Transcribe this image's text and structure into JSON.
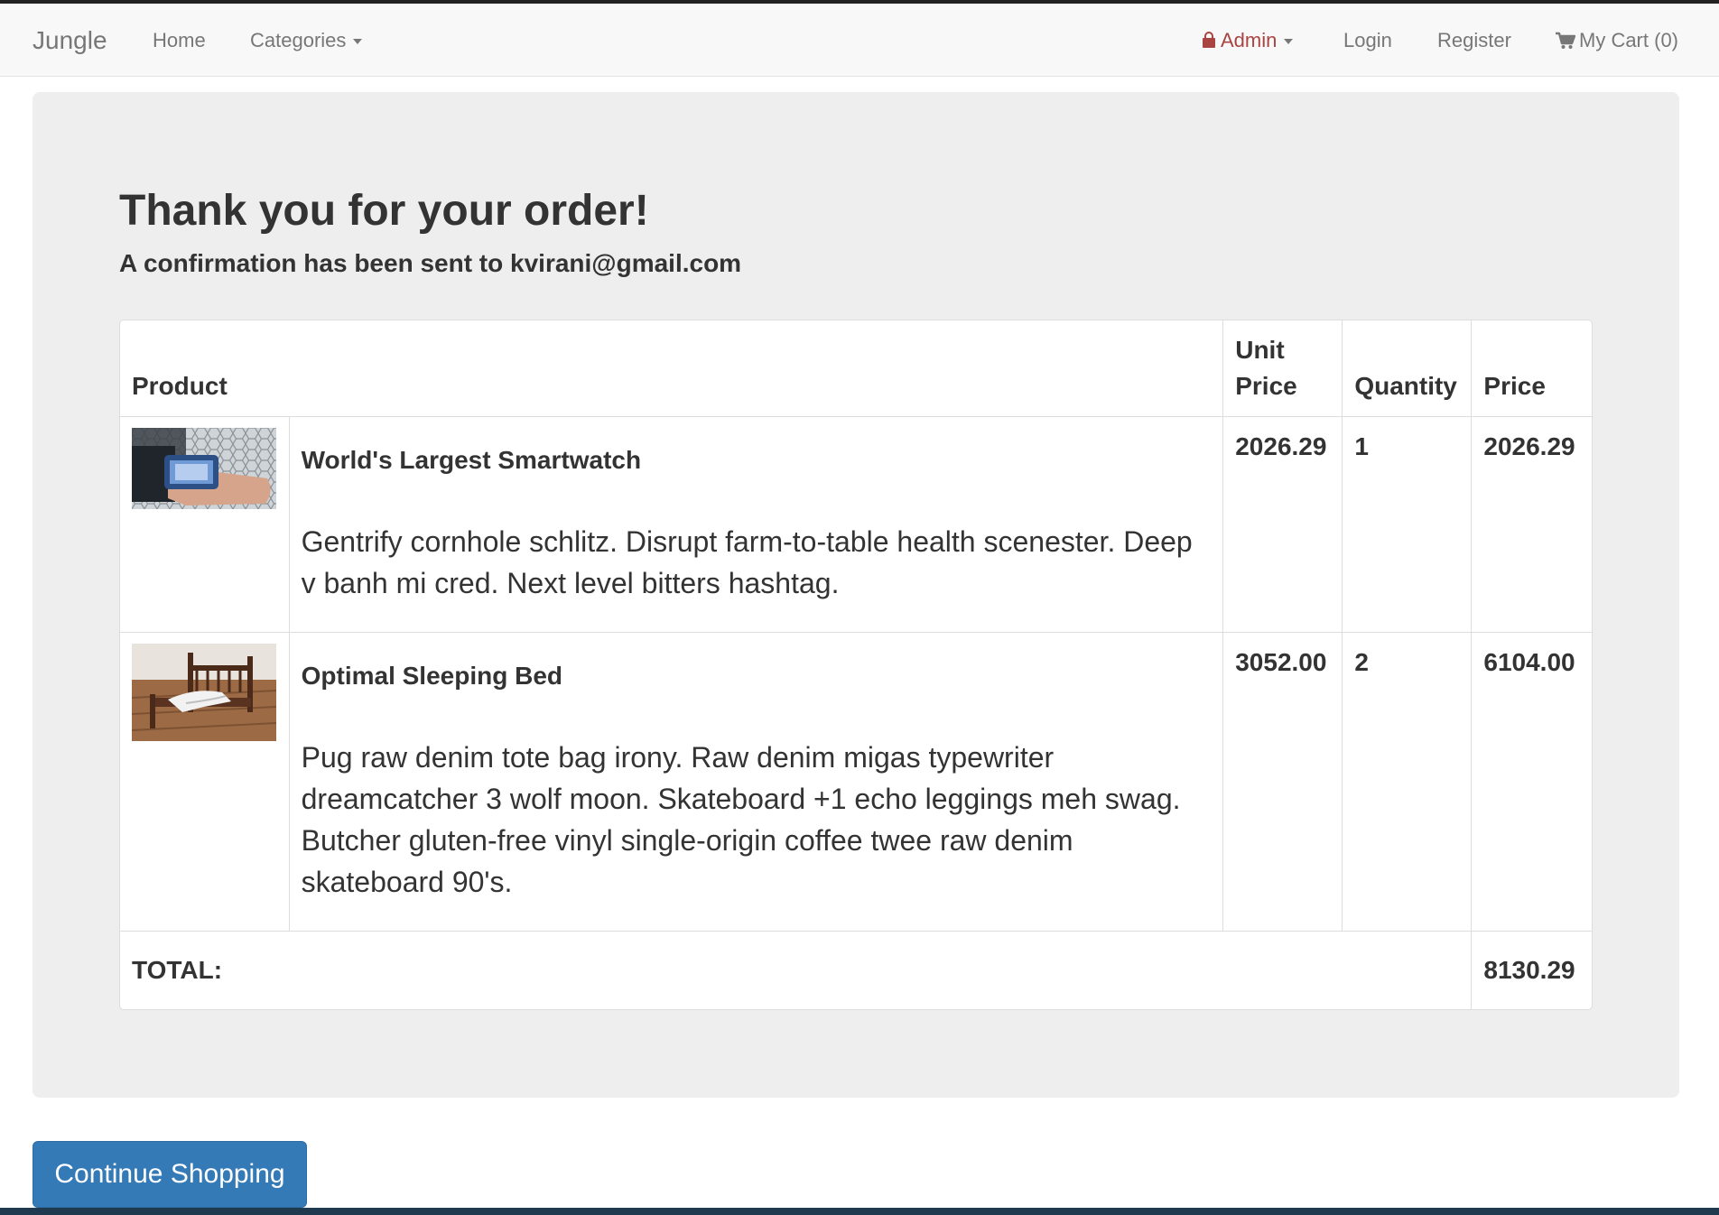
{
  "navbar": {
    "brand": "Jungle",
    "home": "Home",
    "categories": "Categories",
    "admin": "Admin",
    "login": "Login",
    "register": "Register",
    "cart": "My Cart (0)"
  },
  "main": {
    "title": "Thank you for your order!",
    "subtitle": "A confirmation has been sent to kvirani@gmail.com",
    "table": {
      "headers": {
        "product": "Product",
        "unit_price": "Unit Price",
        "quantity": "Quantity",
        "price": "Price"
      },
      "items": [
        {
          "name": "World's Largest Smartwatch",
          "description": "Gentrify cornhole schlitz. Disrupt farm-to-table health scenester. Deep v banh mi cred. Next level bitters hashtag.",
          "unit_price": "2026.29",
          "quantity": "1",
          "price": "2026.29"
        },
        {
          "name": "Optimal Sleeping Bed",
          "description": "Pug raw denim tote bag irony. Raw denim migas typewriter dreamcatcher 3 wolf moon. Skateboard +1 echo leggings meh swag. Butcher gluten-free vinyl single-origin coffee twee raw denim skateboard 90's.",
          "unit_price": "3052.00",
          "quantity": "2",
          "price": "6104.00"
        }
      ],
      "total_label": "TOTAL:",
      "total_value": "8130.29"
    },
    "continue_button": "Continue Shopping"
  },
  "colors": {
    "navbar_bg": "#f8f8f8",
    "admin_red": "#a94442",
    "jumbotron_bg": "#eeeeee",
    "button_blue": "#337ab7"
  },
  "icons": [
    "lock-icon",
    "cart-icon",
    "caret-down-icon"
  ]
}
